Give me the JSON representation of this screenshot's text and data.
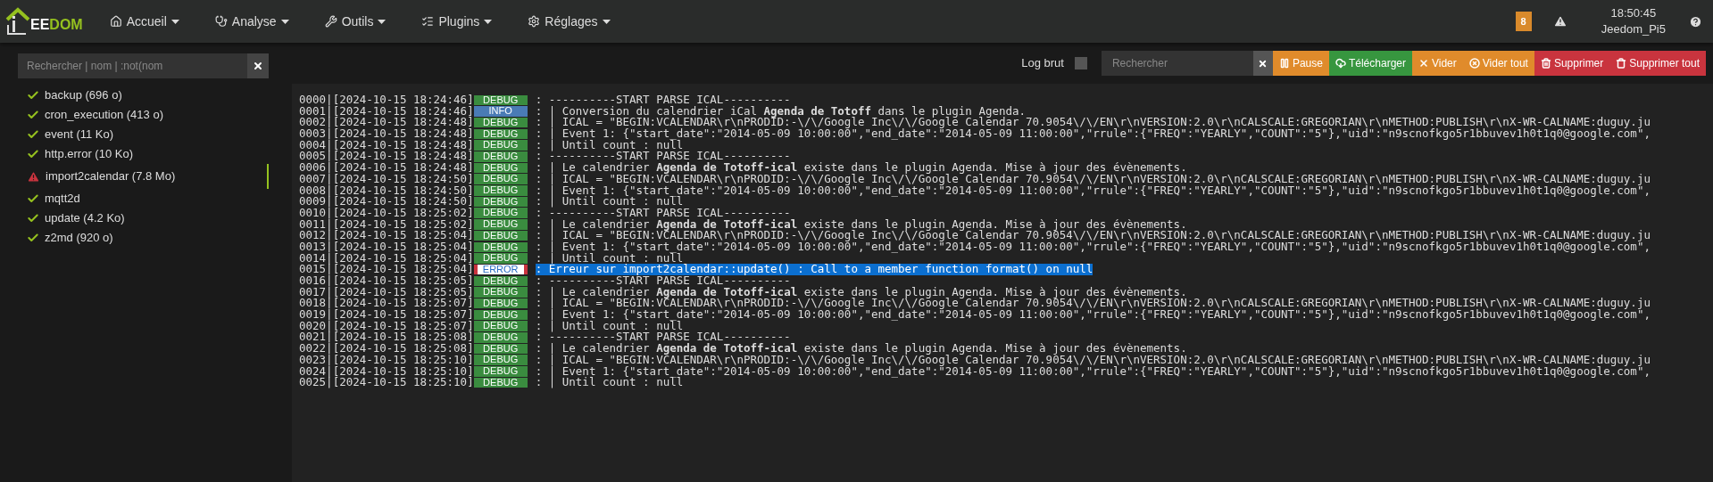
{
  "logo": {
    "light": "EE",
    "accent": "DOM"
  },
  "menu": [
    {
      "label": "Accueil",
      "kind": "home"
    },
    {
      "label": "Analyse",
      "kind": "analyse"
    },
    {
      "label": "Outils",
      "kind": "tools"
    },
    {
      "label": "Plugins",
      "kind": "plugins"
    },
    {
      "label": "Réglages",
      "kind": "settings"
    }
  ],
  "header_right": {
    "badge": "8",
    "time": "18:50:45",
    "host": "Jeedom_Pi5"
  },
  "sidebar": {
    "search": {
      "placeholder": "Rechercher | nom | :not(nom"
    },
    "items": [
      {
        "label": "backup (696 o)",
        "kind": "ok",
        "selected": false
      },
      {
        "label": "cron_execution (413 o)",
        "kind": "ok",
        "selected": false
      },
      {
        "label": "event (11 Ko)",
        "kind": "ok",
        "selected": false
      },
      {
        "label": "http.error (10 Ko)",
        "kind": "ok",
        "selected": false
      },
      {
        "label": "import2calendar (7.8 Mo)",
        "kind": "warning",
        "selected": true
      },
      {
        "label": "mqtt2d",
        "kind": "ok",
        "selected": false
      },
      {
        "label": "update (4.2 Ko)",
        "kind": "ok",
        "selected": false
      },
      {
        "label": "z2md (920 o)",
        "kind": "ok",
        "selected": false
      }
    ]
  },
  "toolbar": {
    "raw_log": {
      "label": "Log brut",
      "checked": false
    },
    "search": {
      "placeholder": "Rechercher"
    },
    "buttons": [
      {
        "label": "Pause",
        "kind": "pause",
        "color": "#e08b2b"
      },
      {
        "label": "Télécharger",
        "kind": "download",
        "color": "#37963f"
      },
      {
        "label": "Vider",
        "kind": "clear",
        "color": "#e08b2b"
      },
      {
        "label": "Vider tout",
        "kind": "clear_all",
        "color": "#e08b2b"
      },
      {
        "label": "Supprimer",
        "kind": "delete",
        "color": "#c9343e"
      },
      {
        "label": "Supprimer tout",
        "kind": "delete_all",
        "color": "#c9343e"
      }
    ]
  },
  "log": [
    {
      "prefix": "0000|[2024-10-15 18:24:46]",
      "kind": "debug",
      "level": "DEBUG",
      "message": ": ----------START PARSE ICAL----------",
      "highlighted": false
    },
    {
      "prefix": "0001|[2024-10-15 18:24:46]",
      "kind": "info",
      "level": "INFO",
      "message": ": | Conversion du calendrier iCal **Agenda de Totoff** dans le plugin Agenda.",
      "highlighted": false
    },
    {
      "prefix": "0002|[2024-10-15 18:24:48]",
      "kind": "debug",
      "level": "DEBUG",
      "message": ": | ICAL = \"BEGIN:VCALENDAR\\r\\nPRODID:-\\/\\/Google Inc\\/\\/Google Calendar 70.9054\\/\\/EN\\r\\nVERSION:2.0\\r\\nCALSCALE:GREGORIAN\\r\\nMETHOD:PUBLISH\\r\\nX-WR-CALNAME:duguy.ju",
      "highlighted": false
    },
    {
      "prefix": "0003|[2024-10-15 18:24:48]",
      "kind": "debug",
      "level": "DEBUG",
      "message": ": | Event 1: {\"start_date\":\"2014-05-09 10:00:00\",\"end_date\":\"2014-05-09 11:00:00\",\"rrule\":{\"FREQ\":\"YEARLY\",\"COUNT\":\"5\"},\"uid\":\"n9scnofkgo5r1bbuvev1h0t1q0@google.com\",",
      "highlighted": false
    },
    {
      "prefix": "0004|[2024-10-15 18:24:48]",
      "kind": "debug",
      "level": "DEBUG",
      "message": ": | Until count : null",
      "highlighted": false
    },
    {
      "prefix": "0005|[2024-10-15 18:24:48]",
      "kind": "debug",
      "level": "DEBUG",
      "message": ": ----------START PARSE ICAL----------",
      "highlighted": false
    },
    {
      "prefix": "0006|[2024-10-15 18:24:48]",
      "kind": "debug",
      "level": "DEBUG",
      "message": ": | Le calendrier **Agenda de Totoff-ical** existe dans le plugin Agenda. Mise à jour des évènements.",
      "highlighted": false
    },
    {
      "prefix": "0007|[2024-10-15 18:24:50]",
      "kind": "debug",
      "level": "DEBUG",
      "message": ": | ICAL = \"BEGIN:VCALENDAR\\r\\nPRODID:-\\/\\/Google Inc\\/\\/Google Calendar 70.9054\\/\\/EN\\r\\nVERSION:2.0\\r\\nCALSCALE:GREGORIAN\\r\\nMETHOD:PUBLISH\\r\\nX-WR-CALNAME:duguy.ju",
      "highlighted": false
    },
    {
      "prefix": "0008|[2024-10-15 18:24:50]",
      "kind": "debug",
      "level": "DEBUG",
      "message": ": | Event 1: {\"start_date\":\"2014-05-09 10:00:00\",\"end_date\":\"2014-05-09 11:00:00\",\"rrule\":{\"FREQ\":\"YEARLY\",\"COUNT\":\"5\"},\"uid\":\"n9scnofkgo5r1bbuvev1h0t1q0@google.com\",",
      "highlighted": false
    },
    {
      "prefix": "0009|[2024-10-15 18:24:50]",
      "kind": "debug",
      "level": "DEBUG",
      "message": ": | Until count : null",
      "highlighted": false
    },
    {
      "prefix": "0010|[2024-10-15 18:25:02]",
      "kind": "debug",
      "level": "DEBUG",
      "message": ": ----------START PARSE ICAL----------",
      "highlighted": false
    },
    {
      "prefix": "0011|[2024-10-15 18:25:02]",
      "kind": "debug",
      "level": "DEBUG",
      "message": ": | Le calendrier **Agenda de Totoff-ical** existe dans le plugin Agenda. Mise à jour des évènements.",
      "highlighted": false
    },
    {
      "prefix": "0012|[2024-10-15 18:25:04]",
      "kind": "debug",
      "level": "DEBUG",
      "message": ": | ICAL = \"BEGIN:VCALENDAR\\r\\nPRODID:-\\/\\/Google Inc\\/\\/Google Calendar 70.9054\\/\\/EN\\r\\nVERSION:2.0\\r\\nCALSCALE:GREGORIAN\\r\\nMETHOD:PUBLISH\\r\\nX-WR-CALNAME:duguy.ju",
      "highlighted": false
    },
    {
      "prefix": "0013|[2024-10-15 18:25:04]",
      "kind": "debug",
      "level": "DEBUG",
      "message": ": | Event 1: {\"start_date\":\"2014-05-09 10:00:00\",\"end_date\":\"2014-05-09 11:00:00\",\"rrule\":{\"FREQ\":\"YEARLY\",\"COUNT\":\"5\"},\"uid\":\"n9scnofkgo5r1bbuvev1h0t1q0@google.com\",",
      "highlighted": false
    },
    {
      "prefix": "0014|[2024-10-15 18:25:04]",
      "kind": "debug",
      "level": "DEBUG",
      "message": ": | Until count : null",
      "highlighted": false
    },
    {
      "prefix": "0015|[2024-10-15 18:25:04]",
      "kind": "error",
      "level": "ERROR",
      "message": ": Erreur sur import2calendar::update() : Call to a member function format() on null",
      "highlighted": true
    },
    {
      "prefix": "0016|[2024-10-15 18:25:05]",
      "kind": "debug",
      "level": "DEBUG",
      "message": ": ----------START PARSE ICAL----------",
      "highlighted": false
    },
    {
      "prefix": "0017|[2024-10-15 18:25:05]",
      "kind": "debug",
      "level": "DEBUG",
      "message": ": | Le calendrier **Agenda de Totoff-ical** existe dans le plugin Agenda. Mise à jour des évènements.",
      "highlighted": false
    },
    {
      "prefix": "0018|[2024-10-15 18:25:07]",
      "kind": "debug",
      "level": "DEBUG",
      "message": ": | ICAL = \"BEGIN:VCALENDAR\\r\\nPRODID:-\\/\\/Google Inc\\/\\/Google Calendar 70.9054\\/\\/EN\\r\\nVERSION:2.0\\r\\nCALSCALE:GREGORIAN\\r\\nMETHOD:PUBLISH\\r\\nX-WR-CALNAME:duguy.ju",
      "highlighted": false
    },
    {
      "prefix": "0019|[2024-10-15 18:25:07]",
      "kind": "debug",
      "level": "DEBUG",
      "message": ": | Event 1: {\"start_date\":\"2014-05-09 10:00:00\",\"end_date\":\"2014-05-09 11:00:00\",\"rrule\":{\"FREQ\":\"YEARLY\",\"COUNT\":\"5\"},\"uid\":\"n9scnofkgo5r1bbuvev1h0t1q0@google.com\",",
      "highlighted": false
    },
    {
      "prefix": "0020|[2024-10-15 18:25:07]",
      "kind": "debug",
      "level": "DEBUG",
      "message": ": | Until count : null",
      "highlighted": false
    },
    {
      "prefix": "0021|[2024-10-15 18:25:08]",
      "kind": "debug",
      "level": "DEBUG",
      "message": ": ----------START PARSE ICAL----------",
      "highlighted": false
    },
    {
      "prefix": "0022|[2024-10-15 18:25:08]",
      "kind": "debug",
      "level": "DEBUG",
      "message": ": | Le calendrier **Agenda de Totoff-ical** existe dans le plugin Agenda. Mise à jour des évènements.",
      "highlighted": false
    },
    {
      "prefix": "0023|[2024-10-15 18:25:10]",
      "kind": "debug",
      "level": "DEBUG",
      "message": ": | ICAL = \"BEGIN:VCALENDAR\\r\\nPRODID:-\\/\\/Google Inc\\/\\/Google Calendar 70.9054\\/\\/EN\\r\\nVERSION:2.0\\r\\nCALSCALE:GREGORIAN\\r\\nMETHOD:PUBLISH\\r\\nX-WR-CALNAME:duguy.ju",
      "highlighted": false
    },
    {
      "prefix": "0024|[2024-10-15 18:25:10]",
      "kind": "debug",
      "level": "DEBUG",
      "message": ": | Event 1: {\"start_date\":\"2014-05-09 10:00:00\",\"end_date\":\"2014-05-09 11:00:00\",\"rrule\":{\"FREQ\":\"YEARLY\",\"COUNT\":\"5\"},\"uid\":\"n9scnofkgo5r1bbuvev1h0t1q0@google.com\",",
      "highlighted": false
    },
    {
      "prefix": "0025|[2024-10-15 18:25:10]",
      "kind": "debug",
      "level": "DEBUG",
      "message": ": | Until count : null",
      "highlighted": false
    }
  ]
}
